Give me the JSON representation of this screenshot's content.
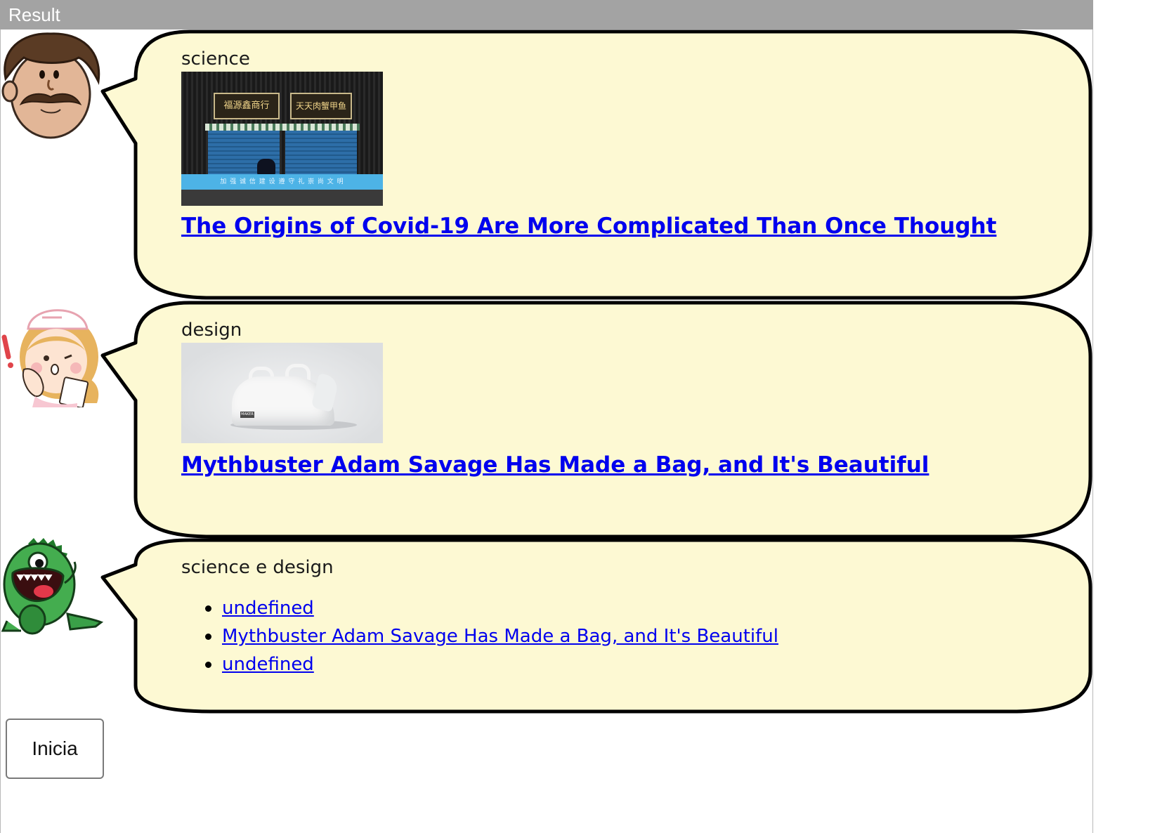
{
  "header": {
    "title": "Result"
  },
  "colors": {
    "bubble_fill": "#fdf9d3",
    "bubble_stroke": "#000000",
    "link": "#0000ee"
  },
  "messages": [
    {
      "avatar": "mustache-man-icon",
      "topic": "science",
      "image_labels": {
        "sign_left": "福源鑫商行",
        "sign_right": "天天肉蟹甲鱼",
        "banner": "加 强 诚 信 建 设 遵 守 礼 崇 尚 文 明"
      },
      "headline": "The Origins of Covid-19 Are More Complicated Than Once Thought"
    },
    {
      "avatar": "nurse-icon",
      "topic": "design",
      "image_labels": {
        "bag_tag": "MAKER"
      },
      "headline": "Mythbuster Adam Savage Has Made a Bag, and It's Beautiful"
    },
    {
      "avatar": "green-dinosaur-icon",
      "topic": "science e design",
      "links": [
        "undefined",
        "Mythbuster Adam Savage Has Made a Bag, and It's Beautiful",
        "undefined"
      ]
    }
  ],
  "controls": {
    "start_label": "Inicia"
  }
}
